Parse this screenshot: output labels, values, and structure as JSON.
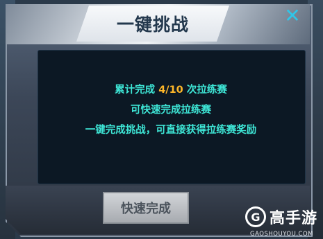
{
  "dialog": {
    "title": "一键挑战",
    "close_glyph": "✕",
    "line1_prefix": "累计完成 ",
    "progress": "4/10",
    "line1_suffix": " 次拉练赛",
    "line2": "可快速完成拉练赛",
    "line3": "一键完成挑战，可直接获得拉练赛奖励",
    "quick_complete_label": "快速完成"
  },
  "watermark": {
    "logo_glyph": "G",
    "name": "高手游",
    "url": "GAOSHOUYOU.COM"
  },
  "colors": {
    "accent_text": "#3ee6d6",
    "progress_highlight": "#ffb829",
    "close_icon": "#2fc6e8"
  }
}
